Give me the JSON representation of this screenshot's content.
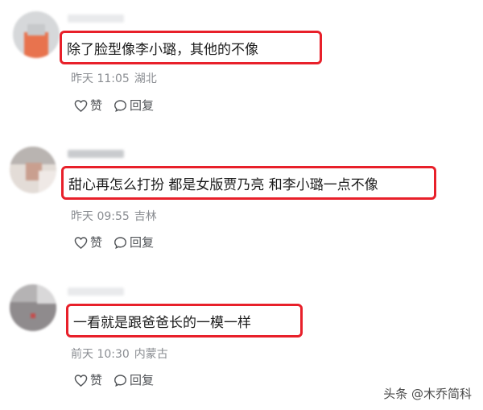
{
  "comments": [
    {
      "text": "除了脸型像李小璐，其他的不像",
      "time": "昨天 11:05",
      "location": "湖北",
      "like_label": "赞",
      "reply_label": "回复"
    },
    {
      "text": "甜心再怎么打扮 都是女版贾乃亮 和李小璐一点不像",
      "time": "昨天 09:55",
      "location": "吉林",
      "like_label": "赞",
      "reply_label": "回复"
    },
    {
      "text": "一看就是跟爸爸长的一模一样",
      "time": "前天 10:30",
      "location": "内蒙古",
      "like_label": "赞",
      "reply_label": "回复"
    }
  ],
  "watermark": "头条 @木乔简科",
  "colors": {
    "highlight_border": "#e8202a",
    "meta_text": "#8a8d92",
    "action_text": "#505357"
  },
  "icons": {
    "like": "heart-icon",
    "reply": "speech-bubble-icon"
  }
}
